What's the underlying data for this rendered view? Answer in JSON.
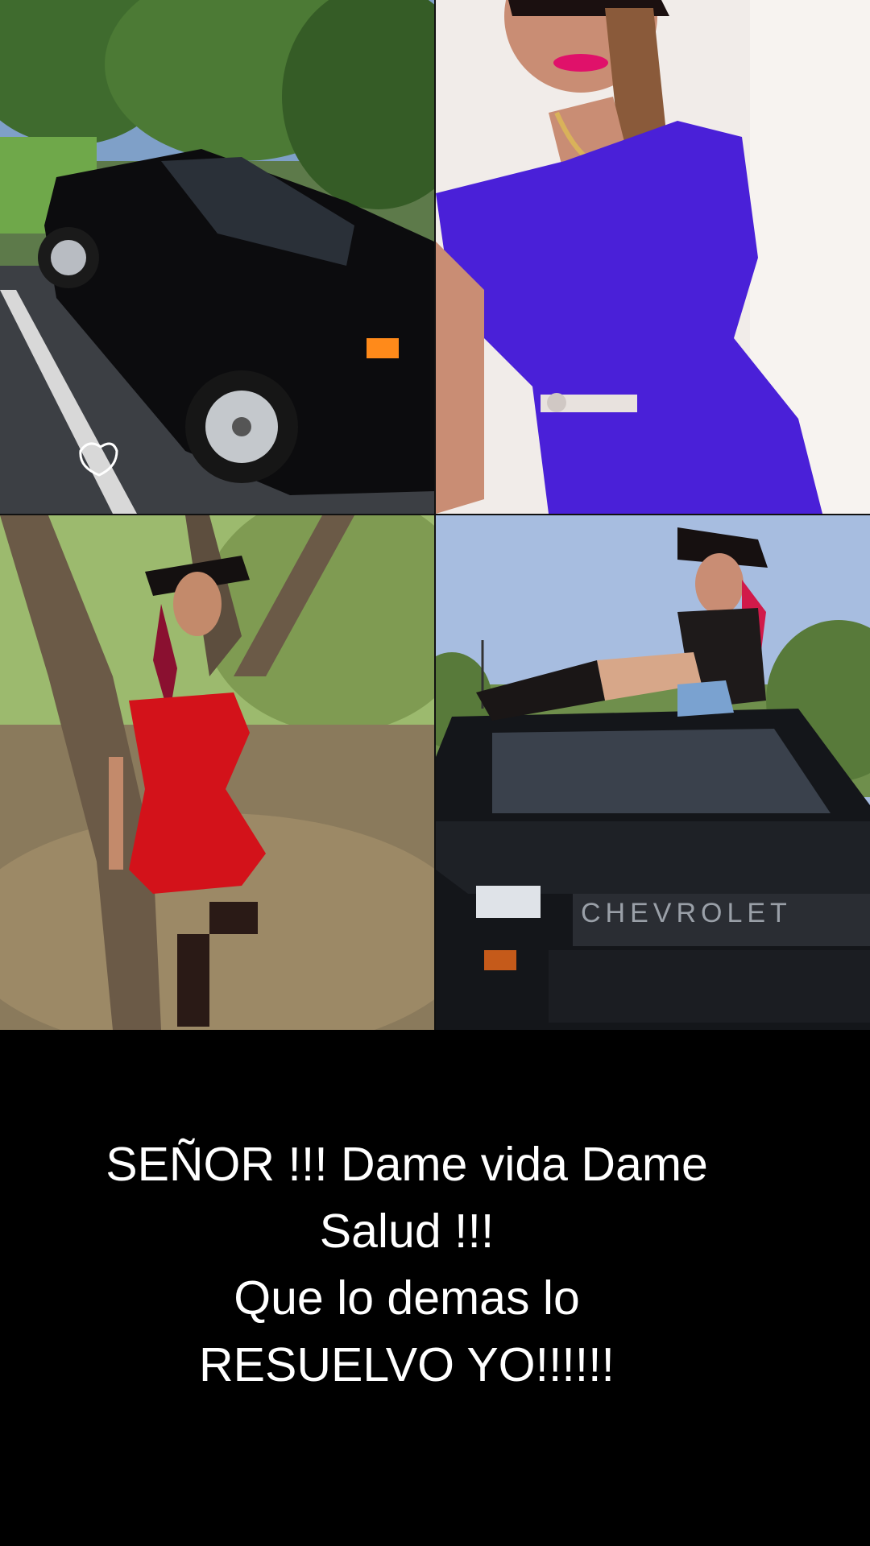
{
  "collage": {
    "photos": [
      {
        "label": "black-pickup-truck-photo"
      },
      {
        "label": "woman-purple-dress-photo"
      },
      {
        "label": "woman-red-dress-tree-photo"
      },
      {
        "label": "woman-on-truck-hood-photo"
      }
    ],
    "truck_grille_text": "CHEVROLET"
  },
  "caption": {
    "line1": "SEÑOR !!! Dame vida Dame",
    "line2": "Salud !!!",
    "line3": "Que lo demas lo",
    "line4": "RESUELVO YO!!!!!!"
  },
  "colors": {
    "background": "#000000",
    "caption_text": "#ffffff"
  }
}
